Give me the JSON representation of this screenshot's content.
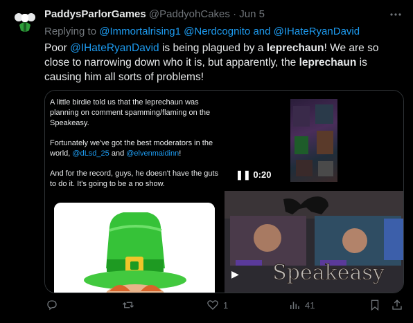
{
  "tweet": {
    "display_name": "PaddysParlorGames",
    "handle": "@PaddyohCakes",
    "separator": "·",
    "date": "Jun 5",
    "replying_prefix": "Replying to",
    "reply_mentions": [
      "@Immortalrising1",
      "@Nerdcognito",
      "@IHateRyanDavid"
    ],
    "reply_and": "and",
    "text_parts": {
      "p1": "Poor ",
      "mention": "@IHateRyanDavid",
      "p2": " is being plagued by a ",
      "bold1": "leprechaun",
      "p3": "! We are so close to narrowing down who it is, but apparently, the ",
      "bold2": "leprechaun",
      "p4": " is causing him all sorts of problems!"
    }
  },
  "card": {
    "para1": "A little birdie told us that the leprechaun was planning on comment spamming/flaming on the Speakeasy.",
    "para2_prefix": "Fortunately we've got the best moderators in the world, ",
    "mod1": "@dLsd_25",
    "para2_and": " and ",
    "mod2": "@elvenmaidinn",
    "para2_suffix": "!",
    "para3": "And for the record, guys, he doesn't have the guts to do it. It's going to be a no show."
  },
  "video": {
    "time": "0:20",
    "overlay_title": "Speakeasy"
  },
  "actions": {
    "reply_count": "",
    "retweet_count": "",
    "like_count": "1",
    "views_count": "41"
  },
  "colors": {
    "background": "#000000",
    "text": "#e7e9ea",
    "muted": "#71767b",
    "link": "#1d9bf0",
    "hat_green": "#3cc23c"
  }
}
